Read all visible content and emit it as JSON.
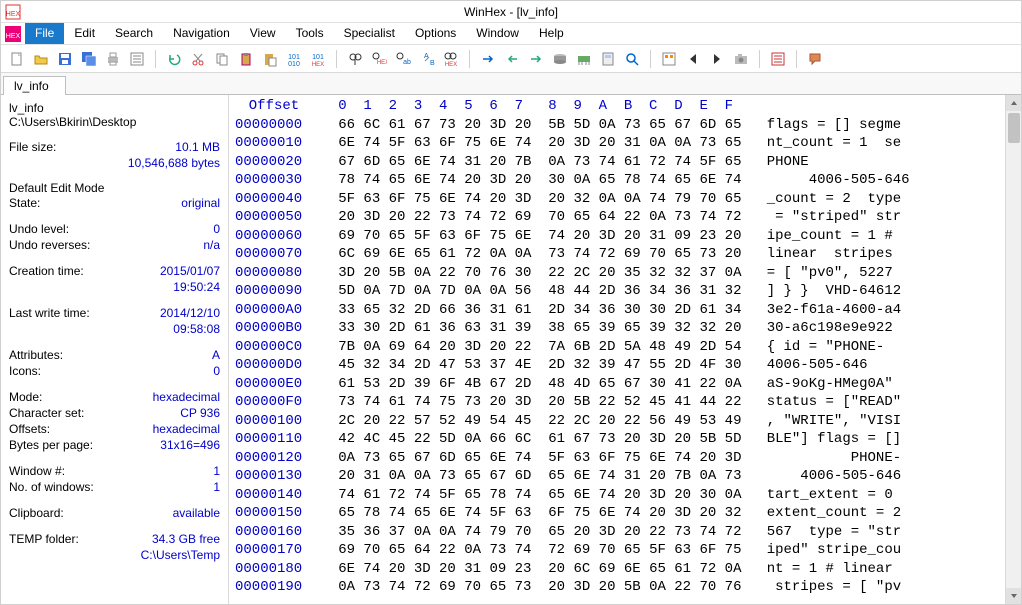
{
  "titlebar": {
    "title": "WinHex - [lv_info]"
  },
  "menu": {
    "items": [
      "File",
      "Edit",
      "Search",
      "Navigation",
      "View",
      "Tools",
      "Specialist",
      "Options",
      "Window",
      "Help"
    ],
    "active_index": 0
  },
  "doctab": {
    "label": "lv_info"
  },
  "info": {
    "title": "lv_info",
    "path": "C:\\Users\\Bkirin\\Desktop",
    "filesize_label": "File size:",
    "filesize_value": "10.1 MB",
    "filesize_bytes": "10,546,688 bytes",
    "editmode_heading": "Default Edit Mode",
    "state_label": "State:",
    "state_value": "original",
    "undolevel_label": "Undo level:",
    "undolevel_value": "0",
    "undorev_label": "Undo reverses:",
    "undorev_value": "n/a",
    "ctime_label": "Creation time:",
    "ctime_date": "2015/01/07",
    "ctime_time": "19:50:24",
    "mtime_label": "Last write time:",
    "mtime_date": "2014/12/10",
    "mtime_time": "09:58:08",
    "attr_label": "Attributes:",
    "attr_value": "A",
    "icons_label": "Icons:",
    "icons_value": "0",
    "mode_label": "Mode:",
    "mode_value": "hexadecimal",
    "charset_label": "Character set:",
    "charset_value": "CP 936",
    "offsets_label": "Offsets:",
    "offsets_value": "hexadecimal",
    "bpp_label": "Bytes per page:",
    "bpp_value": "31x16=496",
    "winnum_label": "Window #:",
    "winnum_value": "1",
    "nwin_label": "No. of windows:",
    "nwin_value": "1",
    "clip_label": "Clipboard:",
    "clip_value": "available",
    "temp_label": "TEMP folder:",
    "temp_value": "34.3 GB free",
    "temp_path": "C:\\Users\\Temp"
  },
  "hex": {
    "offset_label": "Offset",
    "cols": "0  1  2  3  4  5  6  7   8  9  A  B  C  D  E  F",
    "rows": [
      {
        "off": "00000000",
        "b": "66 6C 61 67 73 20 3D 20  5B 5D 0A 73 65 67 6D 65",
        "a": "flags = [] segme"
      },
      {
        "off": "00000010",
        "b": "6E 74 5F 63 6F 75 6E 74  20 3D 20 31 0A 0A 73 65",
        "a": "nt_count = 1  se"
      },
      {
        "off": "00000020",
        "b": "67 6D 65 6E 74 31 20 7B  0A 73 74 61 72 74 5F 65",
        "a": "PHONE"
      },
      {
        "off": "00000030",
        "b": "78 74 65 6E 74 20 3D 20  30 0A 65 78 74 65 6E 74",
        "a": "     4006-505-646"
      },
      {
        "off": "00000040",
        "b": "5F 63 6F 75 6E 74 20 3D  20 32 0A 0A 74 79 70 65",
        "a": "_count = 2  type"
      },
      {
        "off": "00000050",
        "b": "20 3D 20 22 73 74 72 69  70 65 64 22 0A 73 74 72",
        "a": " = \"striped\" str"
      },
      {
        "off": "00000060",
        "b": "69 70 65 5F 63 6F 75 6E  74 20 3D 20 31 09 23 20",
        "a": "ipe_count = 1 # "
      },
      {
        "off": "00000070",
        "b": "6C 69 6E 65 61 72 0A 0A  73 74 72 69 70 65 73 20",
        "a": "linear  stripes "
      },
      {
        "off": "00000080",
        "b": "3D 20 5B 0A 22 70 76 30  22 2C 20 35 32 32 37 0A",
        "a": "= [ \"pv0\", 5227 "
      },
      {
        "off": "00000090",
        "b": "5D 0A 7D 0A 7D 0A 0A 56  48 44 2D 36 34 36 31 32",
        "a": "] } }  VHD-64612"
      },
      {
        "off": "000000A0",
        "b": "33 65 32 2D 66 36 31 61  2D 34 36 30 30 2D 61 34",
        "a": "3e2-f61a-4600-a4"
      },
      {
        "off": "000000B0",
        "b": "33 30 2D 61 36 63 31 39  38 65 39 65 39 32 32 20",
        "a": "30-a6c198e9e922 "
      },
      {
        "off": "000000C0",
        "b": "7B 0A 69 64 20 3D 20 22  7A 6B 2D 5A 48 49 2D 54",
        "a": "{ id = \"PHONE-"
      },
      {
        "off": "000000D0",
        "b": "45 32 34 2D 47 53 37 4E  2D 32 39 47 55 2D 4F 30",
        "a": "4006-505-646"
      },
      {
        "off": "000000E0",
        "b": "61 53 2D 39 6F 4B 67 2D  48 4D 65 67 30 41 22 0A",
        "a": "aS-9oKg-HMeg0A\" "
      },
      {
        "off": "000000F0",
        "b": "73 74 61 74 75 73 20 3D  20 5B 22 52 45 41 44 22",
        "a": "status = [\"READ\""
      },
      {
        "off": "00000100",
        "b": "2C 20 22 57 52 49 54 45  22 2C 20 22 56 49 53 49",
        "a": ", \"WRITE\", \"VISI"
      },
      {
        "off": "00000110",
        "b": "42 4C 45 22 5D 0A 66 6C  61 67 73 20 3D 20 5B 5D",
        "a": "BLE\"] flags = []"
      },
      {
        "off": "00000120",
        "b": "0A 73 65 67 6D 65 6E 74  5F 63 6F 75 6E 74 20 3D",
        "a": "          PHONE-"
      },
      {
        "off": "00000130",
        "b": "20 31 0A 0A 73 65 67 6D  65 6E 74 31 20 7B 0A 73",
        "a": "    4006-505-646"
      },
      {
        "off": "00000140",
        "b": "74 61 72 74 5F 65 78 74  65 6E 74 20 3D 20 30 0A",
        "a": "tart_extent = 0 "
      },
      {
        "off": "00000150",
        "b": "65 78 74 65 6E 74 5F 63  6F 75 6E 74 20 3D 20 32",
        "a": "extent_count = 2"
      },
      {
        "off": "00000160",
        "b": "35 36 37 0A 0A 74 79 70  65 20 3D 20 22 73 74 72",
        "a": "567  type = \"str"
      },
      {
        "off": "00000170",
        "b": "69 70 65 64 22 0A 73 74  72 69 70 65 5F 63 6F 75",
        "a": "iped\" stripe_cou"
      },
      {
        "off": "00000180",
        "b": "6E 74 20 3D 20 31 09 23  20 6C 69 6E 65 61 72 0A",
        "a": "nt = 1 # linear "
      },
      {
        "off": "00000190",
        "b": "0A 73 74 72 69 70 65 73  20 3D 20 5B 0A 22 70 76",
        "a": " stripes = [ \"pv"
      }
    ]
  }
}
